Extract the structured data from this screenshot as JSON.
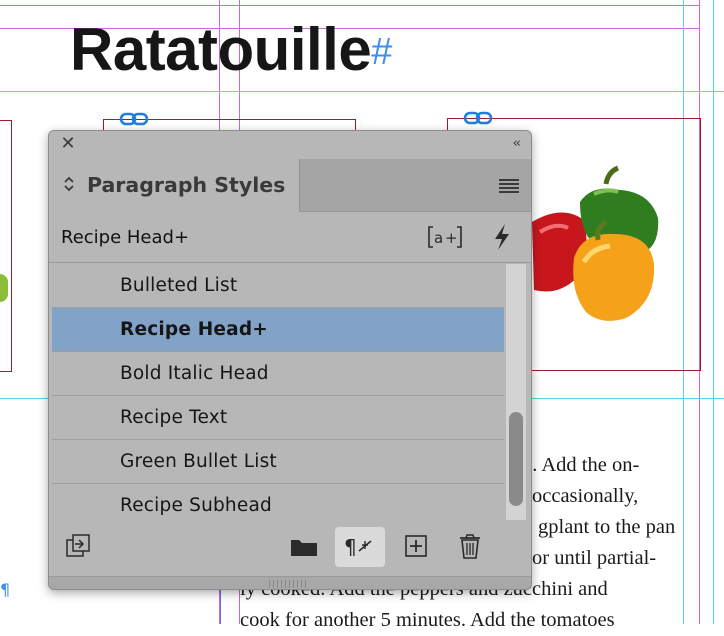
{
  "document": {
    "title": "Ratatouille",
    "title_hash": "#",
    "body_lines": [
      "n. Add the on-",
      "occasionally,",
      "gplant to the pan",
      "or until partial-",
      "ly cooked. Add the peppers and zucchini and",
      "cook for another 5 minutes. Add the tomatoes"
    ],
    "para_mark": "¶"
  },
  "panel": {
    "close_icon": "close-icon",
    "collapse_label": "‹‹",
    "tab_label": "Paragraph Styles",
    "current_style": "Recipe Head+",
    "styles": [
      {
        "label": "Bulleted List",
        "selected": false
      },
      {
        "label": "Recipe Head+",
        "selected": true
      },
      {
        "label": "Bold Italic Head",
        "selected": false
      },
      {
        "label": "Recipe Text",
        "selected": false
      },
      {
        "label": "Green Bullet List",
        "selected": false
      },
      {
        "label": "Recipe Subhead",
        "selected": false
      }
    ],
    "override_label": "[a+]"
  },
  "colors": {
    "selection": "#82a2c8",
    "frame": "#9b1c2a",
    "link_blue": "#1f7ee0"
  }
}
